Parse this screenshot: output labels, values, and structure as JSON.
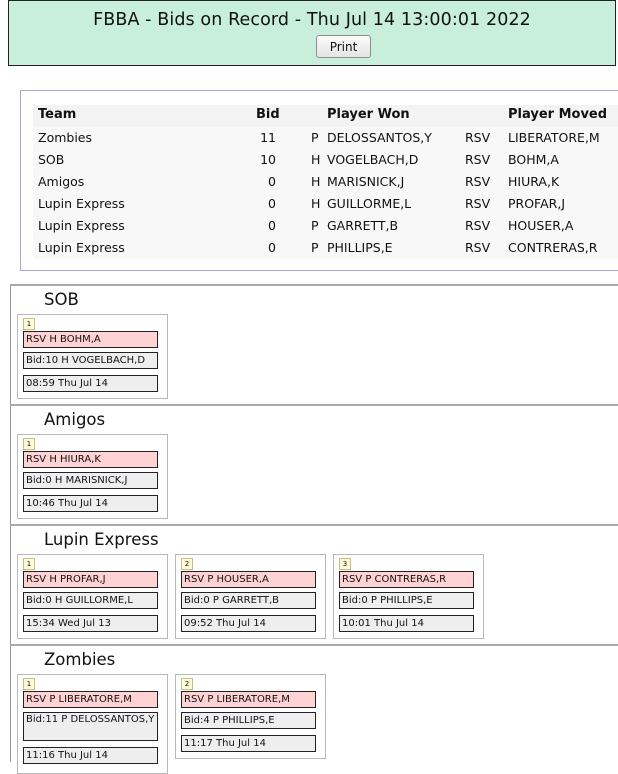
{
  "header": {
    "title": "FBBA - Bids on Record - Thu Jul 14 13:00:01 2022",
    "print_label": "Print"
  },
  "table": {
    "headers": [
      "Team",
      "Bid",
      "Player Won",
      "Player Moved"
    ],
    "rows": [
      {
        "team": "Zombies",
        "bid": "11",
        "won_pos": "P",
        "won": "DELOSSANTOS,Y",
        "status": "RSV",
        "moved": "LIBERATORE,M"
      },
      {
        "team": "SOB",
        "bid": "10",
        "won_pos": "H",
        "won": "VOGELBACH,D",
        "status": "RSV",
        "moved": "BOHM,A"
      },
      {
        "team": "Amigos",
        "bid": "0",
        "won_pos": "H",
        "won": "MARISNICK,J",
        "status": "RSV",
        "moved": "HIURA,K"
      },
      {
        "team": "Lupin Express",
        "bid": "0",
        "won_pos": "H",
        "won": "GUILLORME,L",
        "status": "RSV",
        "moved": "PROFAR,J"
      },
      {
        "team": "Lupin Express",
        "bid": "0",
        "won_pos": "P",
        "won": "GARRETT,B",
        "status": "RSV",
        "moved": "HOUSER,A"
      },
      {
        "team": "Lupin Express",
        "bid": "0",
        "won_pos": "P",
        "won": "PHILLIPS,E",
        "status": "RSV",
        "moved": "CONTRERAS,R"
      }
    ]
  },
  "teams": [
    {
      "name": "SOB",
      "cards": [
        {
          "num": "1",
          "moved": "RSV H BOHM,A",
          "bid": "Bid:10 H VOGELBACH,D",
          "time": "08:59 Thu Jul 14"
        }
      ]
    },
    {
      "name": "Amigos",
      "cards": [
        {
          "num": "1",
          "moved": "RSV H HIURA,K",
          "bid": "Bid:0 H MARISNICK,J",
          "time": "10:46 Thu Jul 14"
        }
      ]
    },
    {
      "name": "Lupin Express",
      "cards": [
        {
          "num": "1",
          "moved": "RSV H PROFAR,J",
          "bid": "Bid:0 H GUILLORME,L",
          "time": "15:34 Wed Jul 13"
        },
        {
          "num": "2",
          "moved": "RSV P HOUSER,A",
          "bid": "Bid:0 P GARRETT,B",
          "time": "09:52 Thu Jul 14"
        },
        {
          "num": "3",
          "moved": "RSV P CONTRERAS,R",
          "bid": "Bid:0 P PHILLIPS,E",
          "time": "10:01 Thu Jul 14"
        }
      ]
    },
    {
      "name": "Zombies",
      "cards": [
        {
          "num": "1",
          "moved": "RSV P LIBERATORE,M",
          "bid": "Bid:11 P DELOSSANTOS,Y",
          "time": "11:16 Thu Jul 14"
        },
        {
          "num": "2",
          "moved": "RSV P LIBERATORE,M",
          "bid": "Bid:4 P PHILLIPS,E",
          "time": "11:17 Thu Jul 14"
        }
      ]
    }
  ]
}
